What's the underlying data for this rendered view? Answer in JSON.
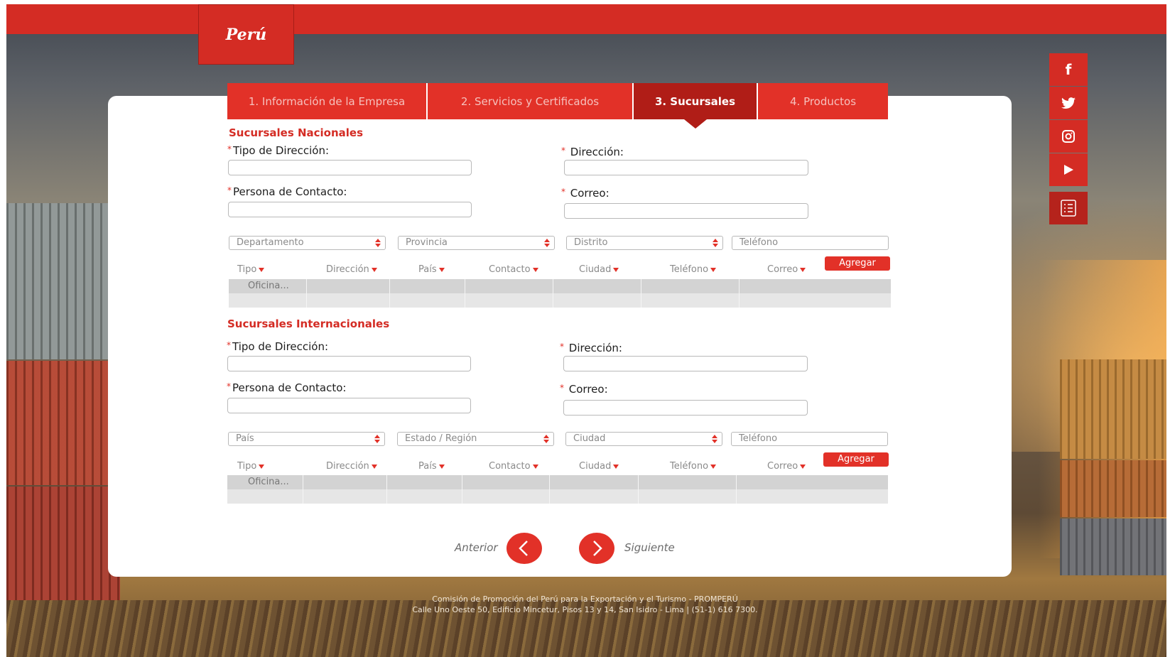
{
  "brand": {
    "logo_text": "Perú"
  },
  "social": [
    {
      "icon": "facebook-icon",
      "glyph": "f"
    },
    {
      "icon": "twitter-icon",
      "glyph": "🐦"
    },
    {
      "icon": "instagram-icon",
      "glyph": "◎"
    },
    {
      "icon": "youtube-icon",
      "glyph": "▶"
    },
    {
      "icon": "checklist-icon",
      "glyph": "☰"
    }
  ],
  "tabs": [
    {
      "label": "1. Información de la Empresa",
      "active": false
    },
    {
      "label": "2. Servicios y Certificados",
      "active": false
    },
    {
      "label": "3. Sucursales",
      "active": true
    },
    {
      "label": "4. Productos",
      "active": false
    }
  ],
  "nacionales": {
    "title": "Sucursales Nacionales",
    "req": "*",
    "tipo_label": "Tipo de Dirección:",
    "direccion_label": "Dirección:",
    "persona_label": "Persona de Contacto:",
    "correo_label": "Correo:",
    "selects": [
      "Departamento",
      "Provincia",
      "Distrito"
    ],
    "telefono_placeholder": "Teléfono",
    "add_label": "Agregar",
    "columns": [
      "Tipo",
      "Dirección",
      "País",
      "Contacto",
      "Ciudad",
      "Teléfono",
      "Correo"
    ],
    "row_value": "Oficina..."
  },
  "internacionales": {
    "title": "Sucursales Internacionales",
    "req": "*",
    "tipo_label": "Tipo de Dirección:",
    "direccion_label": "Dirección:",
    "persona_label": "Persona de Contacto:",
    "correo_label": "Correo:",
    "selects": [
      "País",
      "Estado / Región",
      "Ciudad"
    ],
    "telefono_placeholder": "Teléfono",
    "add_label": "Agregar",
    "columns": [
      "Tipo",
      "Dirección",
      "País",
      "Contacto",
      "Ciudad",
      "Teléfono",
      "Correo"
    ],
    "row_value": "Oficina..."
  },
  "navigation": {
    "prev_label": "Anterior",
    "next_label": "Siguiente"
  },
  "footer": {
    "line1": "Comisión de Promoción del Perú para la Exportación y el Turismo - PROMPERÚ",
    "line2": "Calle Uno Oeste 50, Edificio Mincetur, Pisos 13 y 14, San Isidro - Lima | (51-1) 616 7300."
  },
  "colors": {
    "brand_red": "#d42c24",
    "active_tab": "#b01d17"
  }
}
